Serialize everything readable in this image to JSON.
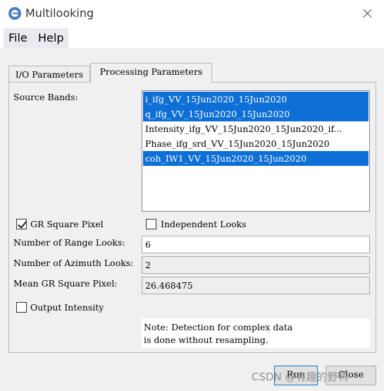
{
  "window": {
    "title": "Multilooking",
    "icon": "esa-snap-icon"
  },
  "menu": {
    "file": "File",
    "help": "Help"
  },
  "tabs": {
    "io": "I/O Parameters",
    "processing": "Processing Parameters",
    "active": "Processing Parameters"
  },
  "source_bands": {
    "label": "Source Bands:",
    "items": [
      {
        "text": "i_ifg_VV_15Jun2020_15Jun2020",
        "selected": true
      },
      {
        "text": "q_ifg_VV_15Jun2020_15Jun2020",
        "selected": true
      },
      {
        "text": "Intensity_ifg_VV_15Jun2020_15Jun2020_if...",
        "selected": false
      },
      {
        "text": "Phase_ifg_srd_VV_15Jun2020_15Jun2020",
        "selected": false
      },
      {
        "text": "coh_IW1_VV_15Jun2020_15Jun2020",
        "selected": true
      }
    ]
  },
  "options": {
    "gr_square_pixel": {
      "label": "GR Square Pixel",
      "checked": true
    },
    "independent_looks": {
      "label": "Independent Looks",
      "checked": false
    },
    "output_intensity": {
      "label": "Output Intensity",
      "checked": false
    }
  },
  "fields": {
    "range_looks": {
      "label": "Number of Range Looks:",
      "value": "6"
    },
    "azimuth_looks": {
      "label": "Number of Azimuth Looks:",
      "value": "2"
    },
    "mean_gr_pixel": {
      "label": "Mean GR Square Pixel:",
      "value": "26.468475"
    }
  },
  "note": "Note: Detection for complex data\nis done without resampling.",
  "buttons": {
    "run": "Run",
    "close": "Close"
  },
  "watermark": "CSDN @有趣的野鸭"
}
